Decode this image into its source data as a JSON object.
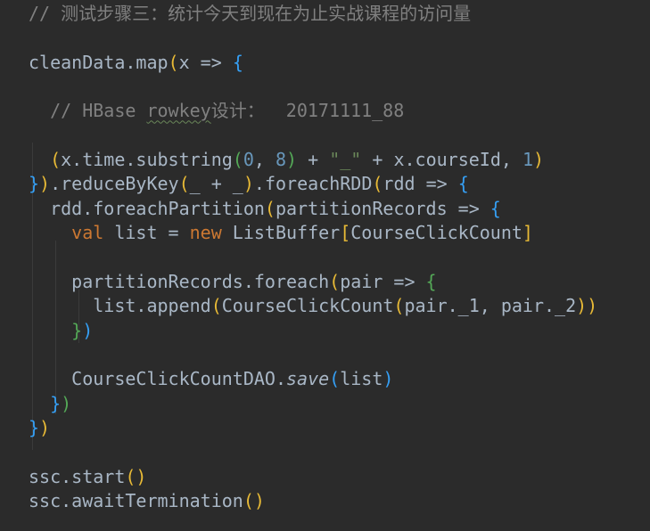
{
  "editor": {
    "theme": {
      "background": "#2b2b2b",
      "foreground": "#a9b7c6",
      "comment": "#808080",
      "number": "#6897bb",
      "string": "#6a8759",
      "keyword": "#cc7832",
      "bracket_level_1": "#e8ba36",
      "bracket_level_2": "#54a857",
      "bracket_level_3": "#359ff4"
    },
    "lines": [
      {
        "tokens": [
          {
            "text": "// 测试步骤三：统计今天到现在为止实战课程的访问量",
            "kind": "comment"
          }
        ]
      },
      {
        "tokens": []
      },
      {
        "tokens": [
          {
            "text": "cleanData.map",
            "kind": "default"
          },
          {
            "text": "(",
            "kind": "b1"
          },
          {
            "text": "x => ",
            "kind": "default"
          },
          {
            "text": "{",
            "kind": "b3"
          }
        ]
      },
      {
        "tokens": []
      },
      {
        "tokens": [
          {
            "text": "  // HBase ",
            "kind": "comment"
          },
          {
            "text": "rowkey",
            "kind": "comment-squiggle"
          },
          {
            "text": "设计：  20171111_88",
            "kind": "comment"
          }
        ]
      },
      {
        "tokens": []
      },
      {
        "tokens": [
          {
            "text": "  ",
            "kind": "default"
          },
          {
            "text": "(",
            "kind": "b1"
          },
          {
            "text": "x.time.substring",
            "kind": "default"
          },
          {
            "text": "(",
            "kind": "b2"
          },
          {
            "text": "0",
            "kind": "num"
          },
          {
            "text": ", ",
            "kind": "default"
          },
          {
            "text": "8",
            "kind": "num"
          },
          {
            "text": ")",
            "kind": "b2"
          },
          {
            "text": " + ",
            "kind": "default"
          },
          {
            "text": "\"_\"",
            "kind": "str"
          },
          {
            "text": " + x.courseId, ",
            "kind": "default"
          },
          {
            "text": "1",
            "kind": "num"
          },
          {
            "text": ")",
            "kind": "b1"
          }
        ]
      },
      {
        "tokens": [
          {
            "text": "}",
            "kind": "b3"
          },
          {
            "text": ")",
            "kind": "b1"
          },
          {
            "text": ".reduceByKey",
            "kind": "default"
          },
          {
            "text": "(",
            "kind": "b1"
          },
          {
            "text": "_ + _",
            "kind": "default"
          },
          {
            "text": ")",
            "kind": "b1"
          },
          {
            "text": ".foreachRDD",
            "kind": "default"
          },
          {
            "text": "(",
            "kind": "b1"
          },
          {
            "text": "rdd => ",
            "kind": "default"
          },
          {
            "text": "{",
            "kind": "b3"
          }
        ]
      },
      {
        "tokens": [
          {
            "text": "  rdd.foreachPartition",
            "kind": "default"
          },
          {
            "text": "(",
            "kind": "b1"
          },
          {
            "text": "partitionRecords => ",
            "kind": "default"
          },
          {
            "text": "{",
            "kind": "b3"
          }
        ]
      },
      {
        "tokens": [
          {
            "text": "    ",
            "kind": "default"
          },
          {
            "text": "val",
            "kind": "kw"
          },
          {
            "text": " list = ",
            "kind": "default"
          },
          {
            "text": "new",
            "kind": "kw"
          },
          {
            "text": " ListBuffer",
            "kind": "default"
          },
          {
            "text": "[",
            "kind": "b1"
          },
          {
            "text": "CourseClickCount",
            "kind": "default"
          },
          {
            "text": "]",
            "kind": "b1"
          }
        ]
      },
      {
        "tokens": []
      },
      {
        "tokens": [
          {
            "text": "    partitionRecords.foreach",
            "kind": "default"
          },
          {
            "text": "(",
            "kind": "b1"
          },
          {
            "text": "pair => ",
            "kind": "default"
          },
          {
            "text": "{",
            "kind": "b2"
          }
        ]
      },
      {
        "tokens": [
          {
            "text": "      list.append",
            "kind": "default"
          },
          {
            "text": "(",
            "kind": "b1"
          },
          {
            "text": "CourseClickCount",
            "kind": "default"
          },
          {
            "text": "(",
            "kind": "b1"
          },
          {
            "text": "pair._1, pair._2",
            "kind": "default"
          },
          {
            "text": ")",
            "kind": "b1"
          },
          {
            "text": ")",
            "kind": "b1"
          }
        ]
      },
      {
        "tokens": [
          {
            "text": "    ",
            "kind": "default"
          },
          {
            "text": "}",
            "kind": "b2"
          },
          {
            "text": ")",
            "kind": "b3"
          }
        ]
      },
      {
        "tokens": []
      },
      {
        "tokens": [
          {
            "text": "    CourseClickCountDAO.",
            "kind": "default"
          },
          {
            "text": "save",
            "kind": "italic"
          },
          {
            "text": "(",
            "kind": "b3"
          },
          {
            "text": "list",
            "kind": "default"
          },
          {
            "text": ")",
            "kind": "b3"
          }
        ]
      },
      {
        "tokens": [
          {
            "text": "  ",
            "kind": "default"
          },
          {
            "text": "}",
            "kind": "b3"
          },
          {
            "text": ")",
            "kind": "b2"
          }
        ]
      },
      {
        "tokens": [
          {
            "text": "}",
            "kind": "b3"
          },
          {
            "text": ")",
            "kind": "b1"
          }
        ]
      },
      {
        "tokens": []
      },
      {
        "tokens": [
          {
            "text": "ssc.start",
            "kind": "default"
          },
          {
            "text": "(",
            "kind": "b1"
          },
          {
            "text": ")",
            "kind": "b1"
          }
        ]
      },
      {
        "tokens": [
          {
            "text": "ssc.awaitTermination",
            "kind": "default"
          },
          {
            "text": "(",
            "kind": "b1"
          },
          {
            "text": ")",
            "kind": "b1"
          }
        ]
      }
    ]
  }
}
